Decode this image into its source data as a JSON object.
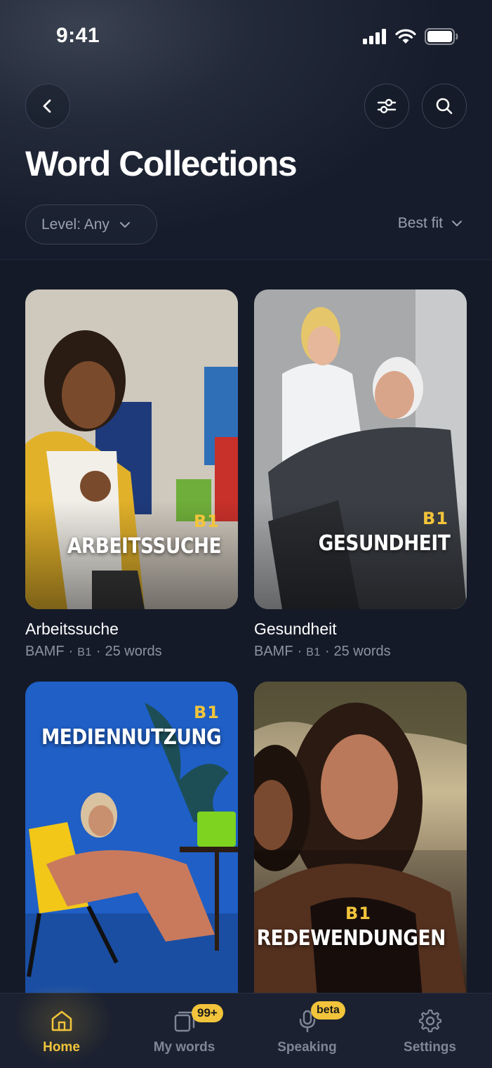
{
  "status_bar": {
    "time": "9:41"
  },
  "header": {
    "title": "Word Collections",
    "level_filter": "Level: Any",
    "sort": "Best fit"
  },
  "collections": [
    {
      "name": "Arbeitssuche",
      "source": "BAMF",
      "level": "B1",
      "words": "25 words",
      "overlay_level": "B1",
      "overlay_title": "ARBEITSSUCHE",
      "accent": "#e5b52a"
    },
    {
      "name": "Gesundheit",
      "source": "BAMF",
      "level": "B1",
      "words": "25 words",
      "overlay_level": "B1",
      "overlay_title": "GESUNDHEIT",
      "accent": "#8d939b"
    },
    {
      "name": "Mediennutzung",
      "overlay_level": "B1",
      "overlay_title": "MEDIENNUTZUNG",
      "accent": "#1d5fc2"
    },
    {
      "name": "Redewendungen",
      "overlay_level": "B1",
      "overlay_title": "REDEWENDUNGEN",
      "accent": "#7a4428"
    }
  ],
  "tabbar": {
    "items": [
      {
        "label": "Home",
        "icon": "home-icon",
        "active": true
      },
      {
        "label": "My words",
        "icon": "cards-icon",
        "badge": "99+"
      },
      {
        "label": "Speaking",
        "icon": "microphone-icon",
        "badge": "beta"
      },
      {
        "label": "Settings",
        "icon": "gear-icon"
      }
    ]
  },
  "colors": {
    "accent": "#f2c43b",
    "background": "#141a28",
    "muted_text": "#8b93a1"
  }
}
